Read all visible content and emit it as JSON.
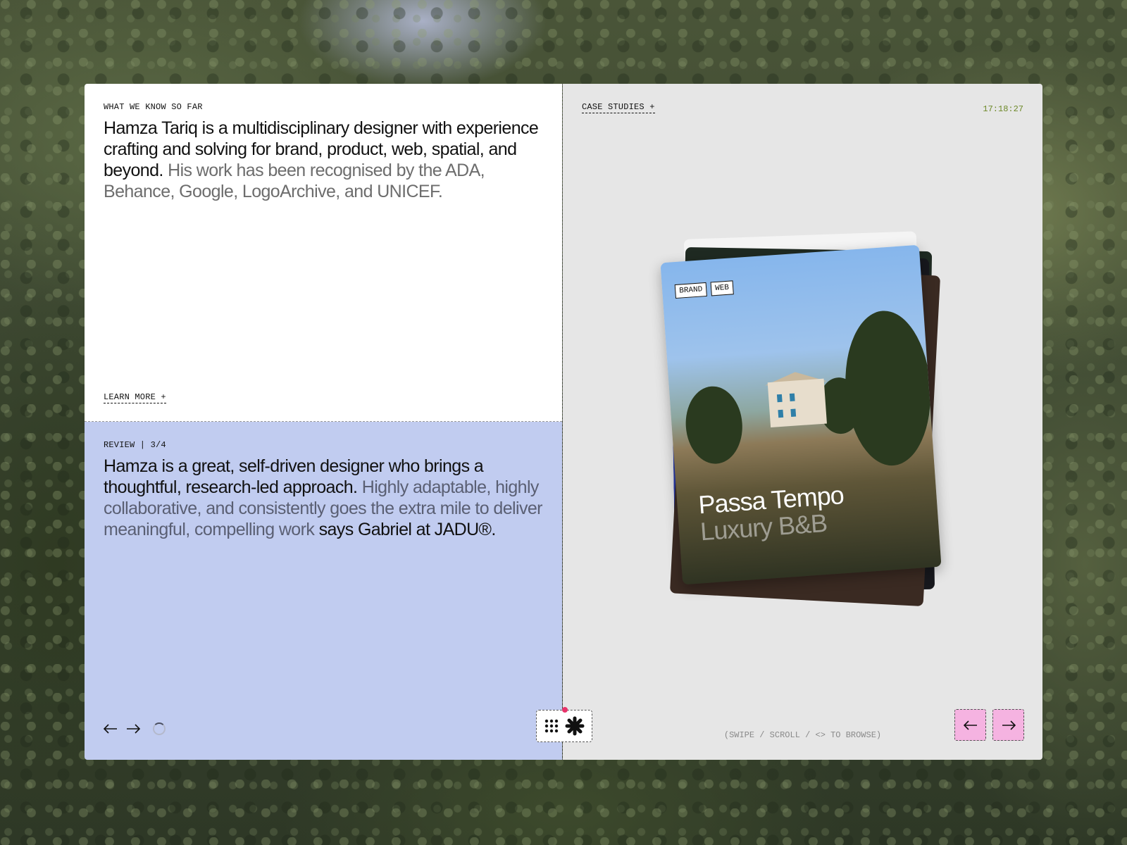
{
  "about": {
    "label": "WHAT WE KNOW SO FAR",
    "text_main": "Hamza Tariq is a multidisciplinary designer with experience crafting and solving for brand, product, web, spatial, and beyond.",
    "text_muted": "His work has been recognised by the ADA, Behance, Google, LogoArchive, and UNICEF.",
    "learn_more": "LEARN MORE +"
  },
  "review": {
    "label": "REVIEW | 3/4",
    "text_main": "Hamza is a great, self-driven designer who brings a thoughtful, research-led approach.",
    "text_muted": "Highly adaptable, highly collaborative, and consistently goes the extra mile to deliver meaningful, compelling work",
    "text_attribution": "says Gabriel at JADU®.",
    "icons": [
      "arrow-left-icon",
      "arrow-right-icon",
      "spinner-icon"
    ]
  },
  "case_studies": {
    "label": "CASE STUDIES +",
    "clock": "17:18:27",
    "hint": "(SWIPE / SCROLL / <> TO BROWSE)",
    "card": {
      "tags": [
        "BRAND",
        "WEB"
      ],
      "title": "Passa Tempo",
      "subtitle": "Luxury B&B"
    }
  },
  "dock": {
    "icons": [
      "grid-icon",
      "asterisk-icon"
    ],
    "status_color": "#e8336a"
  },
  "colors": {
    "review_bg": "#c1ccf0",
    "pager_bg": "#f5b3e1",
    "clock": "#6e8a2a"
  }
}
